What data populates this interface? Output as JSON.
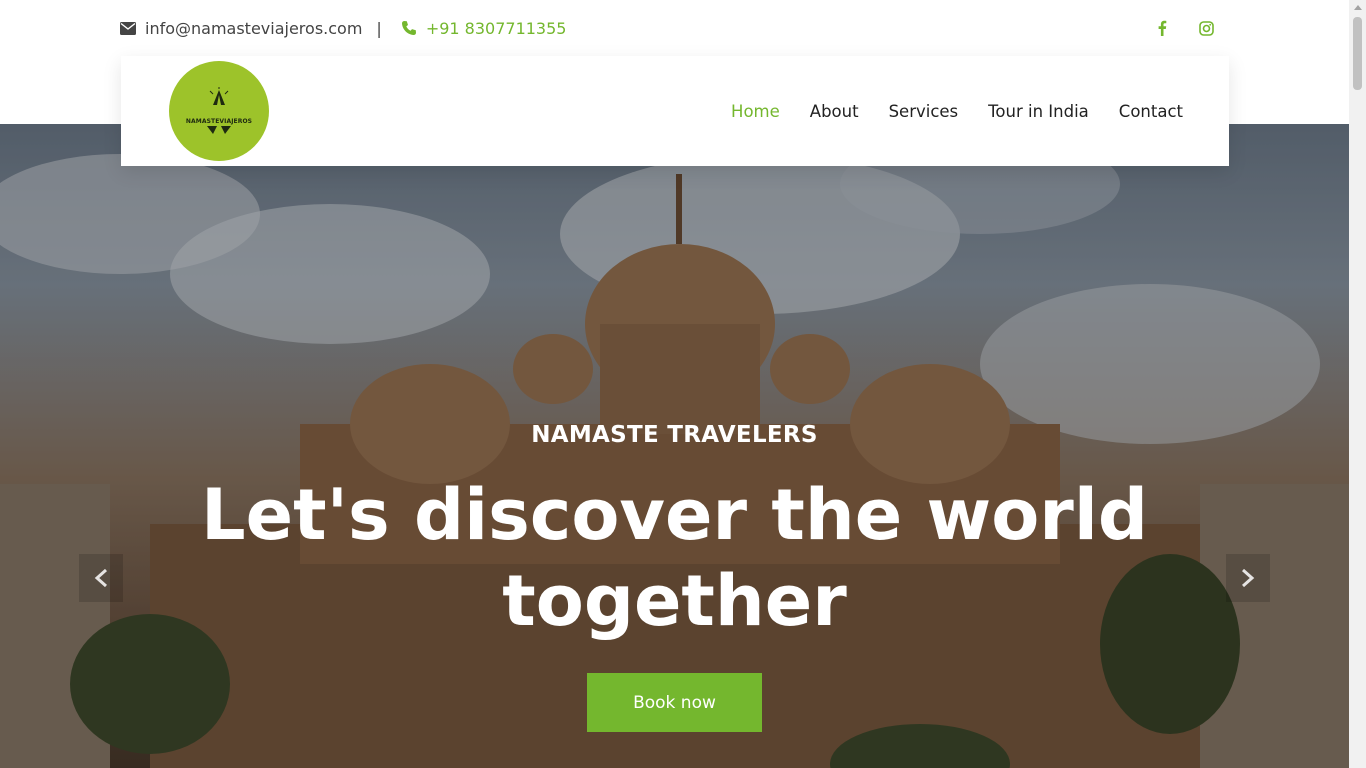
{
  "topbar": {
    "email_icon": "envelope-icon",
    "email": "info@namasteviajeros.com",
    "separator": "|",
    "phone_icon": "phone-icon",
    "phone": "+91 8307711355",
    "social": [
      "facebook-icon",
      "instagram-icon"
    ]
  },
  "brand": {
    "logo_text": "NAMASTEVIAJEROS",
    "logo_color": "#9dc32a"
  },
  "nav": {
    "items": [
      "Home",
      "About",
      "Services",
      "Tour in India",
      "Contact"
    ],
    "active": "Home"
  },
  "hero": {
    "kicker": "NAMASTE TRAVELERS",
    "headline_line1": "Let's discover the world",
    "headline_line2": "together",
    "cta": "Book now",
    "prev_icon": "chevron-left-icon",
    "next_icon": "chevron-right-icon"
  },
  "colors": {
    "accent": "#74b72e",
    "text": "#222222"
  }
}
